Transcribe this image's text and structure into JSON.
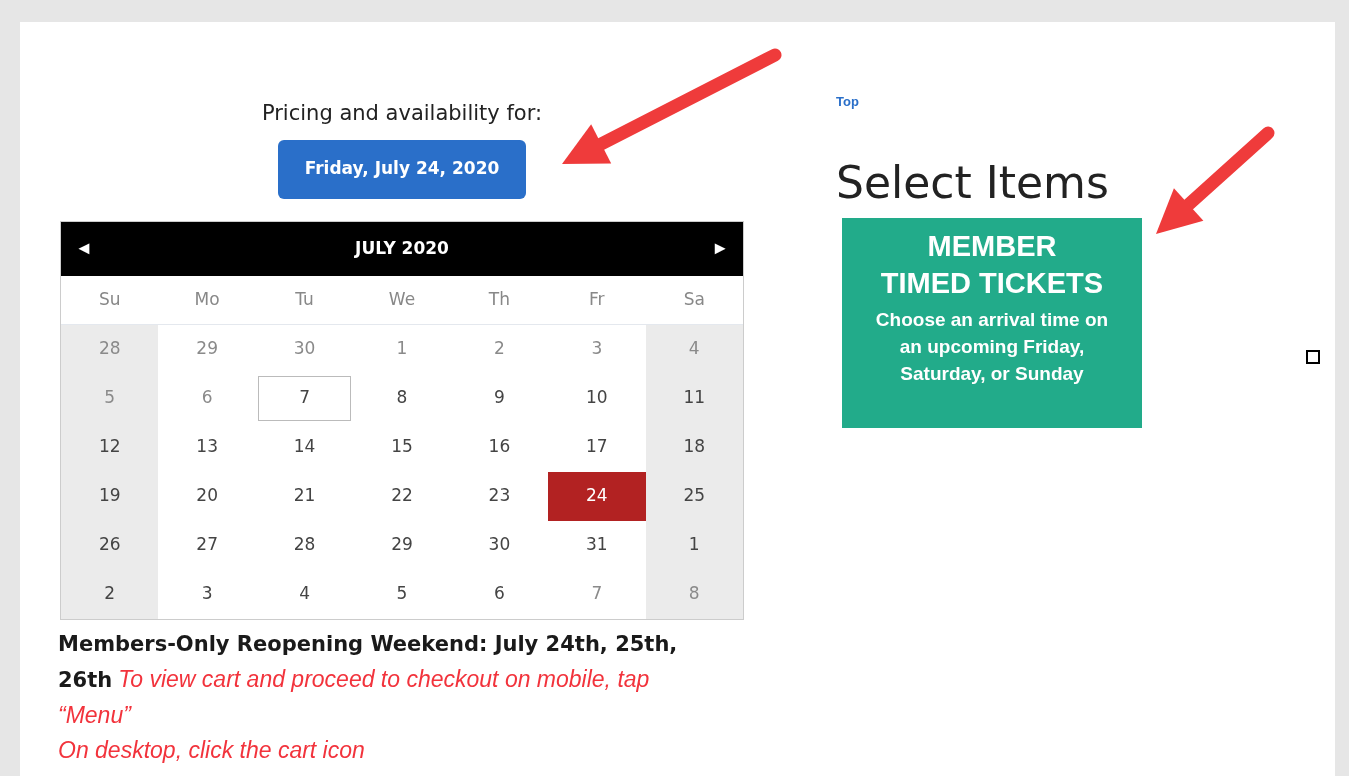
{
  "pricing": {
    "heading": "Pricing and availability for:",
    "date_button": "Friday, July 24, 2020"
  },
  "calendar": {
    "prev": "◄",
    "title": "JULY 2020",
    "next": "►",
    "weekdays": [
      "Su",
      "Mo",
      "Tu",
      "We",
      "Th",
      "Fr",
      "Sa"
    ],
    "days": [
      {
        "label": "28",
        "muted": true,
        "selected": false,
        "today": false
      },
      {
        "label": "29",
        "muted": true,
        "selected": false,
        "today": false
      },
      {
        "label": "30",
        "muted": true,
        "selected": false,
        "today": false
      },
      {
        "label": "1",
        "muted": true,
        "selected": false,
        "today": false
      },
      {
        "label": "2",
        "muted": true,
        "selected": false,
        "today": false
      },
      {
        "label": "3",
        "muted": true,
        "selected": false,
        "today": false
      },
      {
        "label": "4",
        "muted": true,
        "selected": false,
        "today": false
      },
      {
        "label": "5",
        "muted": true,
        "selected": false,
        "today": false
      },
      {
        "label": "6",
        "muted": true,
        "selected": false,
        "today": false
      },
      {
        "label": "7",
        "muted": false,
        "selected": false,
        "today": true
      },
      {
        "label": "8",
        "muted": false,
        "selected": false,
        "today": false
      },
      {
        "label": "9",
        "muted": false,
        "selected": false,
        "today": false
      },
      {
        "label": "10",
        "muted": false,
        "selected": false,
        "today": false
      },
      {
        "label": "11",
        "muted": false,
        "selected": false,
        "today": false
      },
      {
        "label": "12",
        "muted": false,
        "selected": false,
        "today": false
      },
      {
        "label": "13",
        "muted": false,
        "selected": false,
        "today": false
      },
      {
        "label": "14",
        "muted": false,
        "selected": false,
        "today": false
      },
      {
        "label": "15",
        "muted": false,
        "selected": false,
        "today": false
      },
      {
        "label": "16",
        "muted": false,
        "selected": false,
        "today": false
      },
      {
        "label": "17",
        "muted": false,
        "selected": false,
        "today": false
      },
      {
        "label": "18",
        "muted": false,
        "selected": false,
        "today": false
      },
      {
        "label": "19",
        "muted": false,
        "selected": false,
        "today": false
      },
      {
        "label": "20",
        "muted": false,
        "selected": false,
        "today": false
      },
      {
        "label": "21",
        "muted": false,
        "selected": false,
        "today": false
      },
      {
        "label": "22",
        "muted": false,
        "selected": false,
        "today": false
      },
      {
        "label": "23",
        "muted": false,
        "selected": false,
        "today": false
      },
      {
        "label": "24",
        "muted": false,
        "selected": true,
        "today": false
      },
      {
        "label": "25",
        "muted": false,
        "selected": false,
        "today": false
      },
      {
        "label": "26",
        "muted": false,
        "selected": false,
        "today": false
      },
      {
        "label": "27",
        "muted": false,
        "selected": false,
        "today": false
      },
      {
        "label": "28",
        "muted": false,
        "selected": false,
        "today": false
      },
      {
        "label": "29",
        "muted": false,
        "selected": false,
        "today": false
      },
      {
        "label": "30",
        "muted": false,
        "selected": false,
        "today": false
      },
      {
        "label": "31",
        "muted": false,
        "selected": false,
        "today": false
      },
      {
        "label": "1",
        "muted": false,
        "selected": false,
        "today": false
      },
      {
        "label": "2",
        "muted": false,
        "selected": false,
        "today": false
      },
      {
        "label": "3",
        "muted": false,
        "selected": false,
        "today": false
      },
      {
        "label": "4",
        "muted": false,
        "selected": false,
        "today": false
      },
      {
        "label": "5",
        "muted": false,
        "selected": false,
        "today": false
      },
      {
        "label": "6",
        "muted": false,
        "selected": false,
        "today": false
      },
      {
        "label": "7",
        "muted": true,
        "selected": false,
        "today": false
      },
      {
        "label": "8",
        "muted": true,
        "selected": false,
        "today": false
      }
    ]
  },
  "notice": {
    "text": "**Members-Only Reopening Weekend: July 24th, 25th, 26th** *To view cart and proceed to checkout on mobile, tap “Menu”*",
    "desktop_hint": "On desktop, click the cart icon"
  },
  "top_link": "Top",
  "select_items": {
    "title": "Select Items",
    "tile": {
      "title_lines": [
        "MEMBER",
        "TIMED TICKETS"
      ],
      "description": "Choose an arrival time on an upcoming Friday, Saturday, or Sunday"
    }
  },
  "checkbox": {
    "checked": false
  }
}
